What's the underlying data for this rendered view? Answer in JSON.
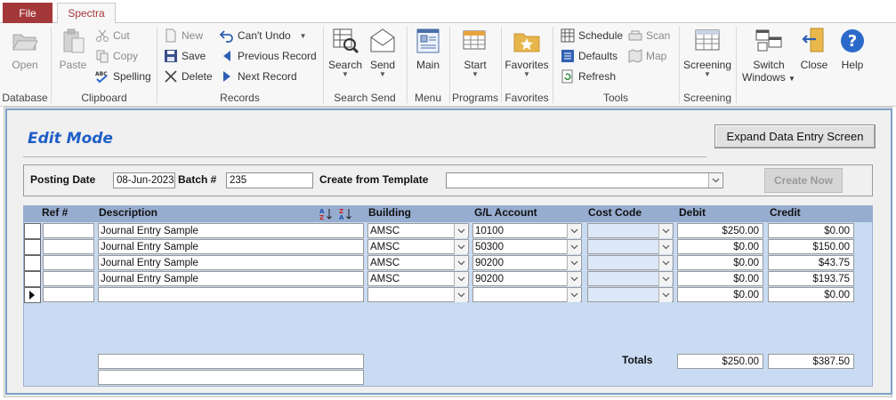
{
  "tabs": {
    "file": "File",
    "spectra": "Spectra"
  },
  "ribbon": {
    "database": {
      "label": "Database",
      "open": "Open"
    },
    "clipboard": {
      "label": "Clipboard",
      "paste": "Paste",
      "cut": "Cut",
      "copy": "Copy",
      "spelling": "Spelling"
    },
    "records": {
      "label": "Records",
      "new": "New",
      "save": "Save",
      "delete": "Delete",
      "cant_undo": "Can't Undo",
      "previous": "Previous Record",
      "next": "Next Record"
    },
    "search_send": {
      "label": "Search Send",
      "search": "Search",
      "send": "Send"
    },
    "menu": {
      "label": "Menu",
      "main": "Main"
    },
    "programs": {
      "label": "Programs",
      "start": "Start"
    },
    "favorites": {
      "label": "Favorites",
      "favorites": "Favorites"
    },
    "tools": {
      "label": "Tools",
      "schedule": "Schedule",
      "defaults": "Defaults",
      "refresh": "Refresh",
      "scan": "Scan",
      "map": "Map"
    },
    "screening": {
      "label": "Screening",
      "screening": "Screening"
    },
    "windows": {
      "switch_line1": "Switch",
      "switch_line2": "Windows",
      "close": "Close",
      "help": "Help"
    }
  },
  "form": {
    "mode_title": "Edit Mode",
    "expand_button": "Expand Data Entry Screen",
    "posting_date_label": "Posting Date",
    "posting_date": "08-Jun-2023",
    "batch_label": "Batch #",
    "batch": "235",
    "template_label": "Create from Template",
    "template_value": "",
    "create_now": "Create Now"
  },
  "grid": {
    "columns": {
      "ref": "Ref #",
      "description": "Description",
      "building": "Building",
      "gl": "G/L Account",
      "cost_code": "Cost Code",
      "debit": "Debit",
      "credit": "Credit"
    },
    "rows": [
      {
        "ref": "",
        "description": "Journal Entry Sample",
        "building": "AMSC",
        "gl": "10100",
        "cost_code": "",
        "debit": "$250.00",
        "credit": "$0.00"
      },
      {
        "ref": "",
        "description": "Journal Entry Sample",
        "building": "AMSC",
        "gl": "50300",
        "cost_code": "",
        "debit": "$0.00",
        "credit": "$150.00"
      },
      {
        "ref": "",
        "description": "Journal Entry Sample",
        "building": "AMSC",
        "gl": "90200",
        "cost_code": "",
        "debit": "$0.00",
        "credit": "$43.75"
      },
      {
        "ref": "",
        "description": "Journal Entry Sample",
        "building": "AMSC",
        "gl": "90200",
        "cost_code": "",
        "debit": "$0.00",
        "credit": "$193.75"
      },
      {
        "ref": "",
        "description": "",
        "building": "",
        "gl": "",
        "cost_code": "",
        "debit": "$0.00",
        "credit": "$0.00"
      }
    ],
    "totals_label": "Totals",
    "total_debit": "$250.00",
    "total_credit": "$387.50",
    "memo1": "",
    "memo2": ""
  }
}
